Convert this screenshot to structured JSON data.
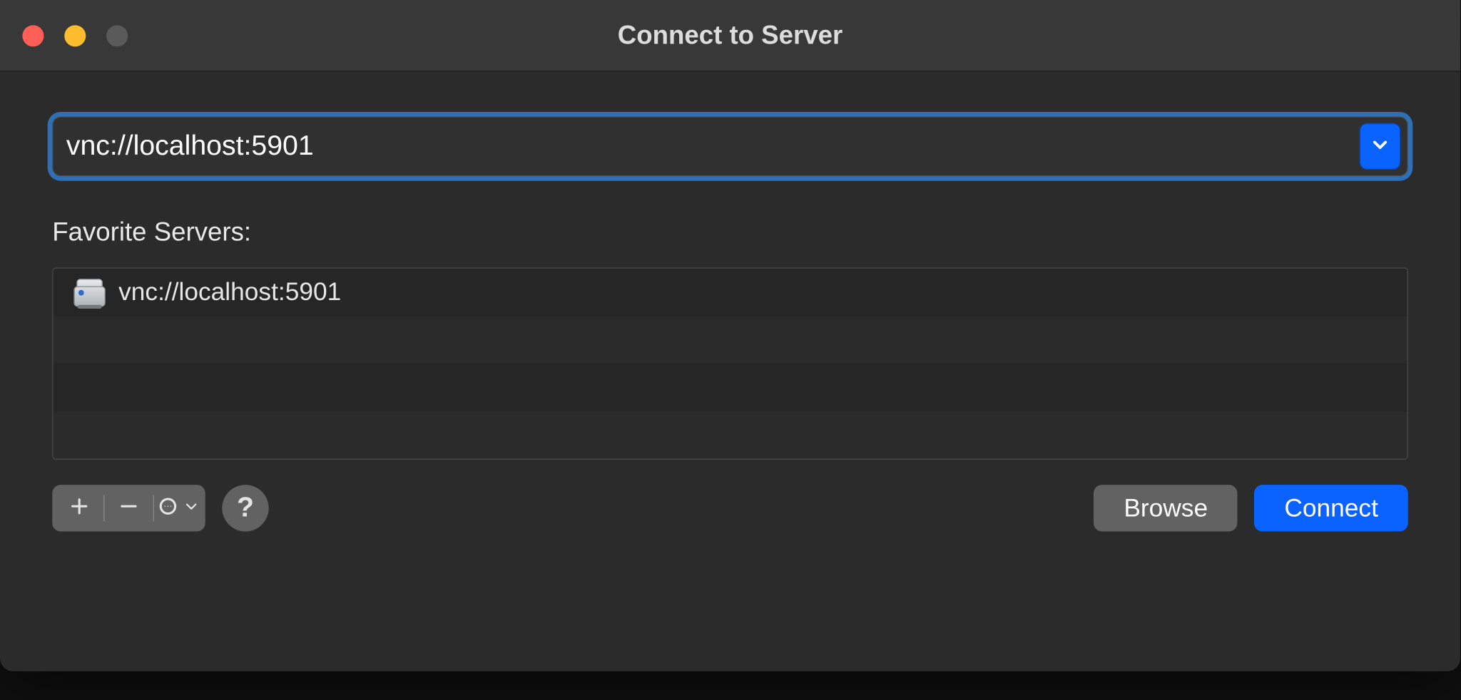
{
  "window": {
    "title": "Connect to Server"
  },
  "address": {
    "value": "vnc://localhost:5901"
  },
  "favorites": {
    "label": "Favorite Servers:",
    "items": [
      {
        "url": "vnc://localhost:5901"
      }
    ]
  },
  "toolbar": {
    "add_name": "add",
    "remove_name": "remove",
    "more_name": "more-actions"
  },
  "buttons": {
    "help": "?",
    "browse": "Browse",
    "connect": "Connect"
  }
}
